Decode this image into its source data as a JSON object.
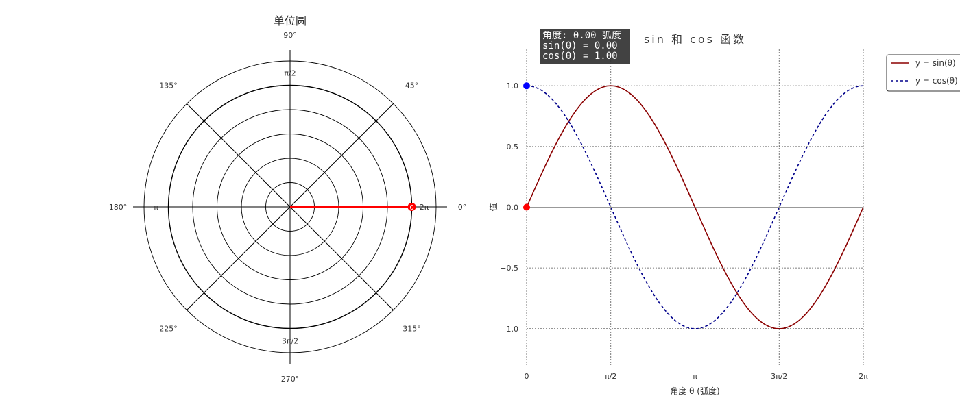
{
  "colors": {
    "sin": "#8b0000",
    "cos": "#00008b",
    "marker_sin": "#ff0000",
    "marker_cos": "#0000ff",
    "radius": "#ff0000"
  },
  "polar": {
    "title": "单位圆",
    "angle_labels": [
      {
        "deg": 0,
        "label": "0°"
      },
      {
        "deg": 45,
        "label": "45°"
      },
      {
        "deg": 90,
        "label": "90°"
      },
      {
        "deg": 135,
        "label": "135°"
      },
      {
        "deg": 180,
        "label": "180°"
      },
      {
        "deg": 225,
        "label": "225°"
      },
      {
        "deg": 270,
        "label": "270°"
      },
      {
        "deg": 315,
        "label": "315°"
      }
    ],
    "radian_labels": [
      {
        "deg": 0,
        "label": "2π"
      },
      {
        "deg": 90,
        "label": "π/2"
      },
      {
        "deg": 180,
        "label": "π"
      },
      {
        "deg": 270,
        "label": "3π/2"
      }
    ],
    "point_label": "0"
  },
  "info": {
    "angle": "角度: 0.00 弧度",
    "sin": "sin(θ) = 0.00",
    "cos": "cos(θ) = 1.00"
  },
  "chart_data": [
    {
      "type": "polar",
      "title": "单位圆",
      "rlim": [
        0,
        1.2
      ],
      "r_gridlines": [
        0.2,
        0.4,
        0.6,
        0.8,
        1.0,
        1.2
      ],
      "theta_gridlines_deg": [
        0,
        45,
        90,
        135,
        180,
        225,
        270,
        315
      ],
      "current_angle_rad": 0.0,
      "point": {
        "r": 1.0,
        "theta": 0.0
      }
    },
    {
      "type": "line",
      "title": "sin 和 cos 函数",
      "xlabel": "角度 θ (弧度)",
      "ylabel": "值",
      "xlim": [
        0,
        6.2832
      ],
      "ylim": [
        -1.3,
        1.3
      ],
      "xticks": [
        {
          "value": 0,
          "label": "0"
        },
        {
          "value": 1.5708,
          "label": "π/2"
        },
        {
          "value": 3.1416,
          "label": "π"
        },
        {
          "value": 4.7124,
          "label": "3π/2"
        },
        {
          "value": 6.2832,
          "label": "2π"
        }
      ],
      "yticks": [
        {
          "value": -1.0,
          "label": "−1.0"
        },
        {
          "value": -0.5,
          "label": "−0.5"
        },
        {
          "value": 0.0,
          "label": "0.0"
        },
        {
          "value": 0.5,
          "label": "0.5"
        },
        {
          "value": 1.0,
          "label": "1.0"
        }
      ],
      "grid": true,
      "legend_position": "outside-right-top",
      "series": [
        {
          "name": "y = sin(θ)",
          "style": "solid",
          "color": "#8b0000",
          "x": [
            0,
            0.3927,
            0.7854,
            1.1781,
            1.5708,
            1.9635,
            2.3562,
            2.7489,
            3.1416,
            3.5343,
            3.927,
            4.3197,
            4.7124,
            5.1051,
            5.4978,
            5.8905,
            6.2832
          ],
          "values": [
            0,
            0.383,
            0.707,
            0.924,
            1.0,
            0.924,
            0.707,
            0.383,
            0,
            -0.383,
            -0.707,
            -0.924,
            -1.0,
            -0.924,
            -0.707,
            -0.383,
            0
          ]
        },
        {
          "name": "y = cos(θ)",
          "style": "dashed",
          "color": "#00008b",
          "x": [
            0,
            0.3927,
            0.7854,
            1.1781,
            1.5708,
            1.9635,
            2.3562,
            2.7489,
            3.1416,
            3.5343,
            3.927,
            4.3197,
            4.7124,
            5.1051,
            5.4978,
            5.8905,
            6.2832
          ],
          "values": [
            1.0,
            0.924,
            0.707,
            0.383,
            0,
            -0.383,
            -0.707,
            -0.924,
            -1.0,
            -0.924,
            -0.707,
            -0.383,
            0,
            0.383,
            0.707,
            0.924,
            1.0
          ]
        }
      ],
      "markers": [
        {
          "series": "y = sin(θ)",
          "x": 0,
          "y": 0.0
        },
        {
          "series": "y = cos(θ)",
          "x": 0,
          "y": 1.0
        }
      ]
    }
  ]
}
